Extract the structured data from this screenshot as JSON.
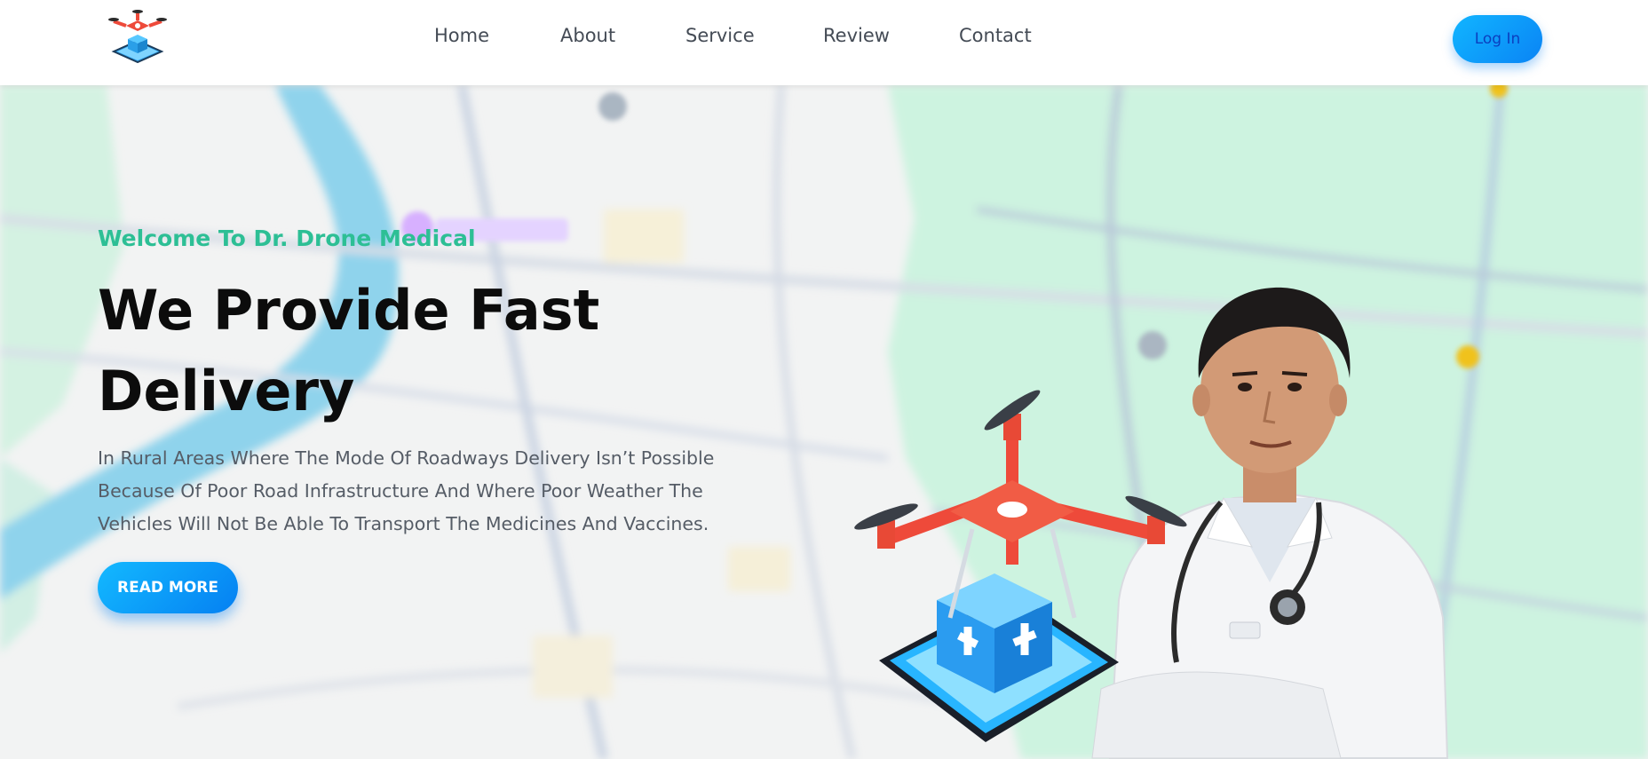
{
  "header": {
    "logo_icon": "drone-medical-logo",
    "nav": [
      {
        "label": "Home"
      },
      {
        "label": "About"
      },
      {
        "label": "Service"
      },
      {
        "label": "Review"
      },
      {
        "label": "Contact"
      }
    ],
    "login_label": "Log In"
  },
  "hero": {
    "welcome": "Welcome To Dr. Drone Medical",
    "headline_line1": "We Provide Fast",
    "headline_line2": "Delivery",
    "description": "In Rural Areas Where The Mode Of Roadways Delivery Isn’t Possible Because Of Poor Road Infrastructure And Where Poor Weather The Vehicles Will Not Be Able To Transport The Medicines And Vaccines.",
    "read_more_label": "READ MORE",
    "background_icon": "map-background",
    "illustration_icon": "doctor-with-drone-illustration"
  },
  "colors": {
    "accent_green": "#2dbf95",
    "button_blue": "#0a84f5",
    "headline": "#0c0c0c",
    "body_text": "#555c66"
  }
}
